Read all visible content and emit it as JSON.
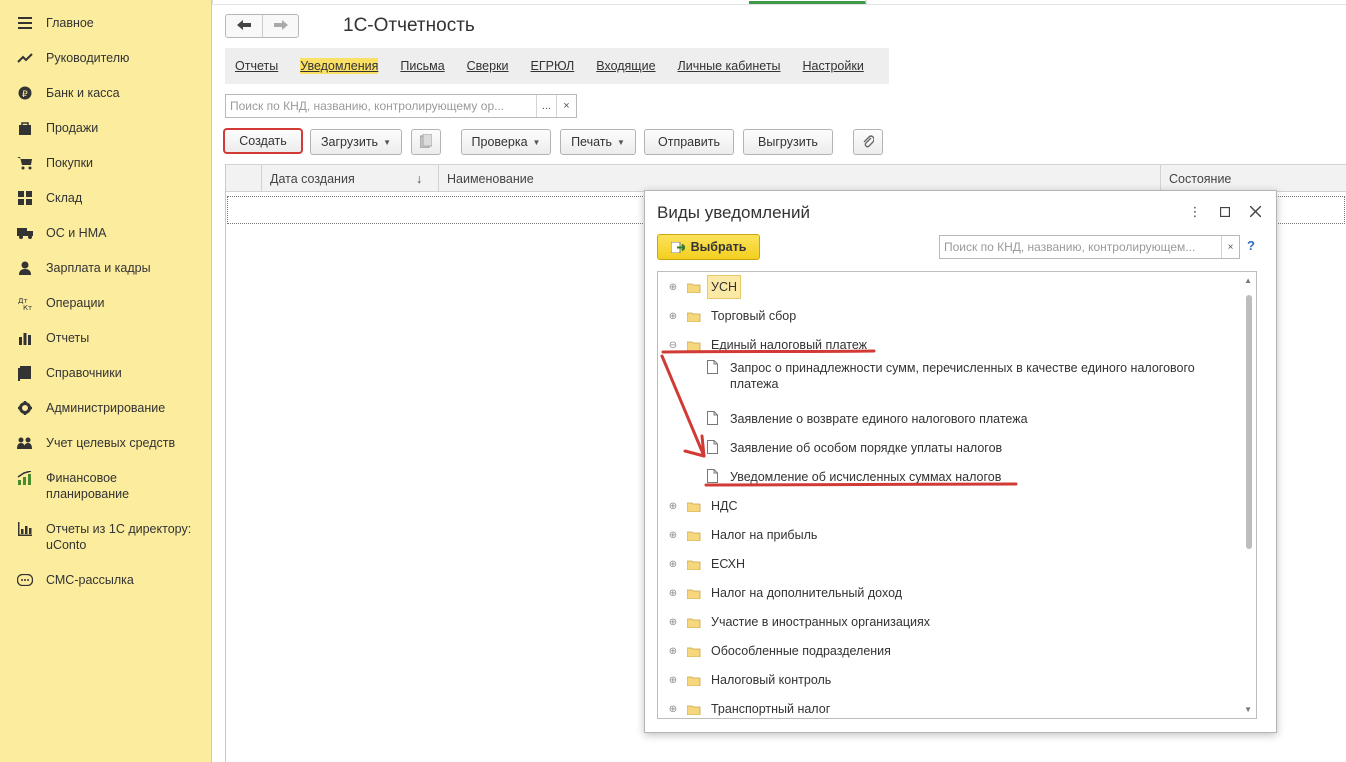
{
  "sidebar": {
    "items": [
      {
        "label": "Главное",
        "icon": "menu-icon"
      },
      {
        "label": "Руководителю",
        "icon": "trend-icon"
      },
      {
        "label": "Банк и касса",
        "icon": "ruble-coin-icon"
      },
      {
        "label": "Продажи",
        "icon": "shopping-bag-icon"
      },
      {
        "label": "Покупки",
        "icon": "cart-icon"
      },
      {
        "label": "Склад",
        "icon": "warehouse-grid-icon"
      },
      {
        "label": "ОС и НМА",
        "icon": "truck-icon"
      },
      {
        "label": "Зарплата и кадры",
        "icon": "person-icon"
      },
      {
        "label": "Операции",
        "icon": "dt-kt-icon"
      },
      {
        "label": "Отчеты",
        "icon": "bar-chart-icon"
      },
      {
        "label": "Справочники",
        "icon": "book-icon"
      },
      {
        "label": "Администрирование",
        "icon": "gear-icon"
      },
      {
        "label": "Учет целевых средств",
        "icon": "people-icon"
      },
      {
        "label": "Финансовое планирование",
        "icon": "growth-chart-icon"
      },
      {
        "label": "Отчеты из 1С директору: uConto",
        "icon": "report-chart-icon"
      },
      {
        "label": "СМС-рассылка",
        "icon": "sms-icon"
      }
    ]
  },
  "header": {
    "title": "1С-Отчетность",
    "back_symbol": "🡐",
    "forward_symbol": "🡒"
  },
  "tabs": [
    {
      "label": "Отчеты",
      "active": false
    },
    {
      "label": "Уведомления",
      "active": true
    },
    {
      "label": "Письма",
      "active": false
    },
    {
      "label": "Сверки",
      "active": false
    },
    {
      "label": "ЕГРЮЛ",
      "active": false
    },
    {
      "label": "Входящие",
      "active": false
    },
    {
      "label": "Личные кабинеты",
      "active": false
    },
    {
      "label": "Настройки",
      "active": false
    }
  ],
  "search": {
    "placeholder": "Поиск по КНД, названию, контролирующему ор...",
    "more": "...",
    "clear": "×"
  },
  "toolbar": {
    "create": "Создать",
    "load": "Загрузить",
    "check": "Проверка",
    "print": "Печать",
    "send": "Отправить",
    "unload": "Выгрузить"
  },
  "grid": {
    "columns": [
      "Дата создания",
      "Наименование",
      "Состояние"
    ],
    "sort_symbol": "↓"
  },
  "dialog": {
    "title": "Виды уведомлений",
    "choose": "Выбрать",
    "search_placeholder": "Поиск по КНД, названию, контролирующем...",
    "clear": "×",
    "help": "?",
    "menu_symbol": "⋮",
    "maximize_symbol": "☐",
    "close_symbol": "✕",
    "tree": [
      {
        "label": "УСН",
        "type": "folder",
        "expanded": false,
        "selected": true,
        "level": 0
      },
      {
        "label": "Торговый сбор",
        "type": "folder",
        "expanded": false,
        "level": 0
      },
      {
        "label": "Единый налоговый платеж",
        "type": "folder",
        "expanded": true,
        "level": 0
      },
      {
        "label": "Запрос о принадлежности сумм, перечисленных в качестве единого налогового платежа",
        "type": "doc",
        "level": 1
      },
      {
        "label": "Заявление о возврате единого налогового платежа",
        "type": "doc",
        "level": 1
      },
      {
        "label": "Заявление об особом порядке уплаты налогов",
        "type": "doc",
        "level": 1
      },
      {
        "label": "Уведомление об исчисленных суммах налогов",
        "type": "doc",
        "level": 1
      },
      {
        "label": "НДС",
        "type": "folder",
        "expanded": false,
        "level": 0
      },
      {
        "label": "Налог на прибыль",
        "type": "folder",
        "expanded": false,
        "level": 0
      },
      {
        "label": "ЕСХН",
        "type": "folder",
        "expanded": false,
        "level": 0
      },
      {
        "label": "Налог на дополнительный доход",
        "type": "folder",
        "expanded": false,
        "level": 0
      },
      {
        "label": "Участие в иностранных организациях",
        "type": "folder",
        "expanded": false,
        "level": 0
      },
      {
        "label": "Обособленные подразделения",
        "type": "folder",
        "expanded": false,
        "level": 0
      },
      {
        "label": "Налоговый контроль",
        "type": "folder",
        "expanded": false,
        "level": 0
      },
      {
        "label": "Транспортный налог",
        "type": "folder",
        "expanded": false,
        "level": 0
      }
    ]
  },
  "colors": {
    "sidebar_bg": "#fbec9e",
    "accent_yellow": "#f3cf21",
    "annotation_red": "#d23a36",
    "link_blue": "#2a6fc9"
  }
}
